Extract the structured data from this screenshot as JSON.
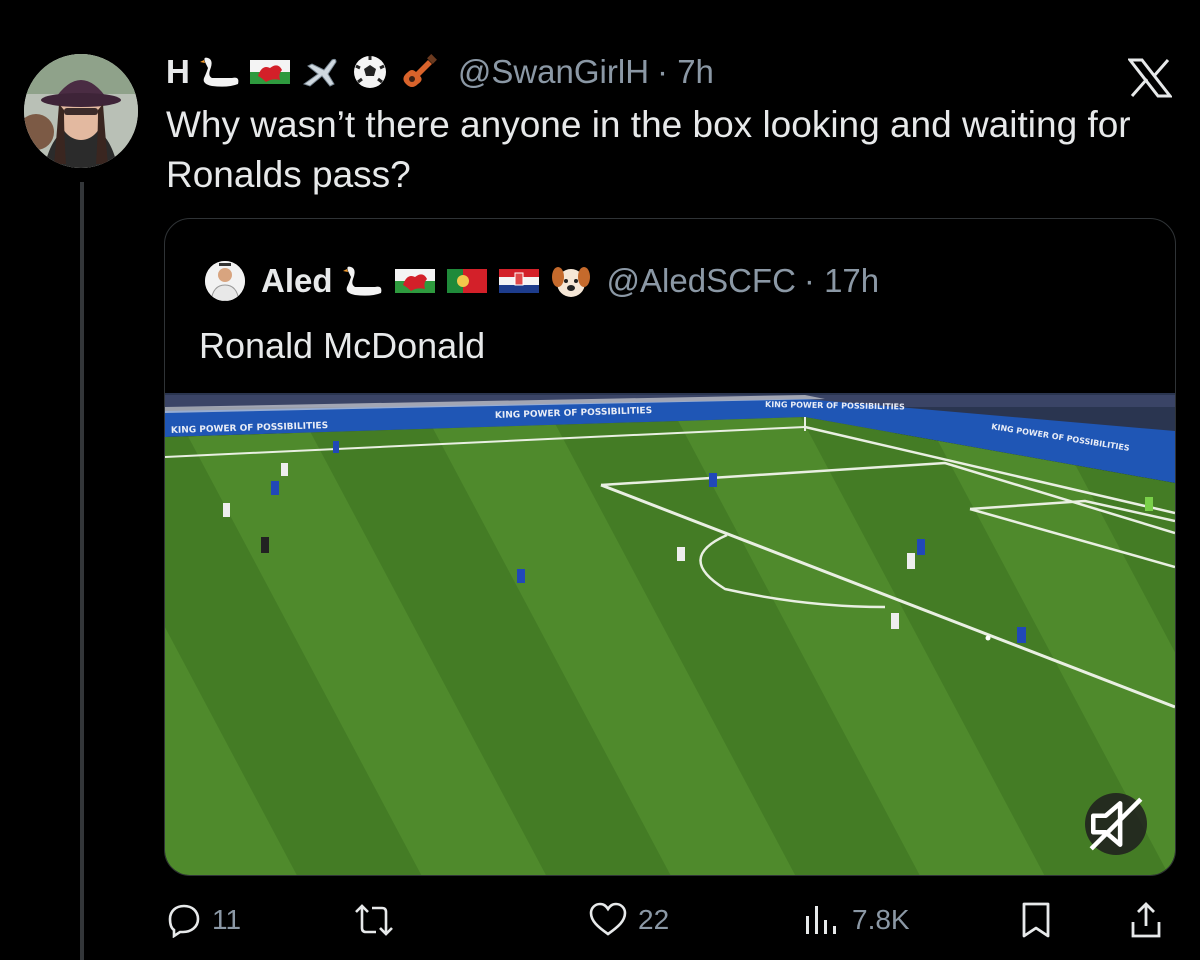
{
  "tweet": {
    "display_name": "H",
    "name_emojis": [
      "swan-emoji",
      "wales-flag-emoji",
      "airplane-emoji",
      "soccer-ball-emoji",
      "guitar-emoji"
    ],
    "handle": "@SwanGirlH",
    "time": "· 7h",
    "text": "Why wasn’t there anyone in the box  looking and waiting for Ronalds pass?"
  },
  "quote": {
    "display_name": "Aled",
    "name_emojis": [
      "swan-emoji",
      "wales-flag-emoji",
      "portugal-flag-emoji",
      "croatia-flag-emoji",
      "dog-face-emoji"
    ],
    "handle": "@AledSCFC",
    "time": "· 17h",
    "text": "Ronald McDonald",
    "video": {
      "banner_text_1": "KING POWER OF POSSIBILITIES",
      "banner_text_2": "KING POWER OF POSSIBILITIES",
      "banner_text_3": "KING POWER OF POSSIBILITIES",
      "banner_text_4": "KING POWER OF POSSIBILITIES"
    }
  },
  "actions": {
    "replies": "11",
    "reposts": "",
    "likes": "22",
    "views": "7.8K"
  },
  "colors": {
    "background": "#000000",
    "text": "#e7e9ea",
    "secondary_text": "#8b98a5",
    "border": "#2f3336",
    "pitch_green": "#4f8a2c"
  }
}
